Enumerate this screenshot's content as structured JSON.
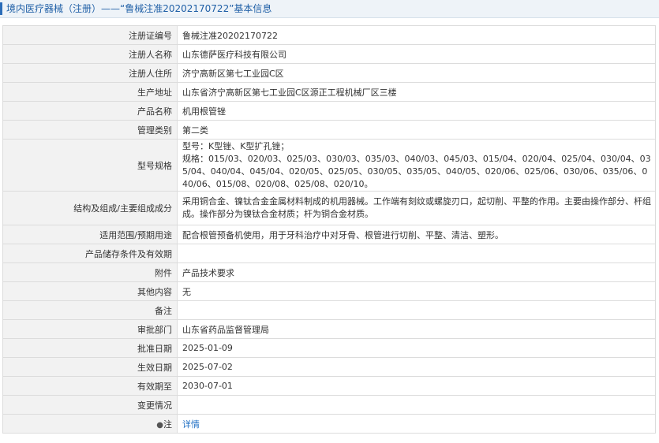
{
  "header": {
    "title": "境内医疗器械（注册）——“鲁械注准20202170722”基本信息"
  },
  "rows": {
    "reg_no": {
      "label": "注册证编号",
      "value": "鲁械注准20202170722"
    },
    "registrant_name": {
      "label": "注册人名称",
      "value": "山东德萨医疗科技有限公司"
    },
    "registrant_addr": {
      "label": "注册人住所",
      "value": "济宁高新区第七工业园C区"
    },
    "production_addr": {
      "label": "生产地址",
      "value": "山东省济宁高新区第七工业园C区源正工程机械厂区三楼"
    },
    "product_name": {
      "label": "产品名称",
      "value": "机用根管锉"
    },
    "category": {
      "label": "管理类别",
      "value": "第二类"
    },
    "model_spec": {
      "label": "型号规格",
      "line1": "型号：K型锉、K型扩孔锉；",
      "line2": "规格：015/03、020/03、025/03、030/03、035/03、040/03、045/03、015/04、020/04、025/04、030/04、035/04、040/04、045/04、020/05、025/05、030/05、035/05、040/05、020/06、025/06、030/06、035/06、040/06、015/08、020/08、025/08、020/10。"
    },
    "structure": {
      "label": "结构及组成/主要组成成分",
      "value": "采用铜合金、镍钛合金金属材料制成的机用器械。工作端有刻纹或螺旋刃口，起切削、平整的作用。主要由操作部分、杆组成。操作部分为镍钛合金材质；杆为铜合金材质。"
    },
    "usage": {
      "label": "适用范围/预期用途",
      "value": "配合根管预备机使用，用于牙科治疗中对牙骨、根管进行切削、平整、清洁、塑形。"
    },
    "storage": {
      "label": "产品储存条件及有效期",
      "value": ""
    },
    "attachment": {
      "label": "附件",
      "value": "产品技术要求"
    },
    "other": {
      "label": "其他内容",
      "value": "无"
    },
    "remark": {
      "label": "备注",
      "value": ""
    },
    "approval_dept": {
      "label": "审批部门",
      "value": "山东省药品监督管理局"
    },
    "approval_date": {
      "label": "批准日期",
      "value": "2025-01-09"
    },
    "effective_date": {
      "label": "生效日期",
      "value": "2025-07-02"
    },
    "expiry_date": {
      "label": "有效期至",
      "value": "2030-07-01"
    },
    "change": {
      "label": "变更情况",
      "value": ""
    },
    "note": {
      "label": "注",
      "icon": "pin-icon",
      "link": "详情"
    }
  }
}
